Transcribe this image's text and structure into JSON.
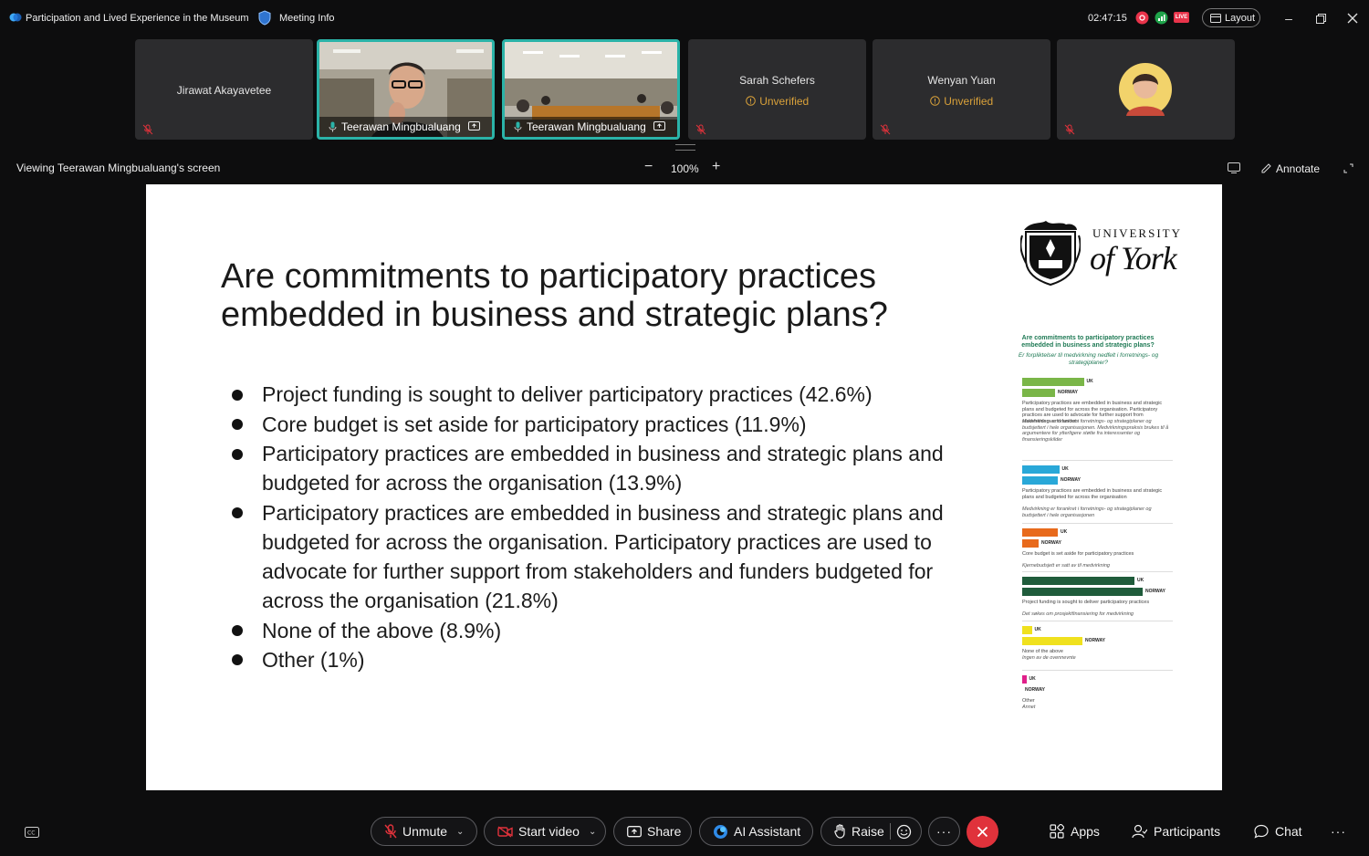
{
  "window": {
    "meeting_title": "Participation and Lived Experience in the Museum",
    "meeting_info": "Meeting Info",
    "elapsed": "02:47:15",
    "live_badge": "LIVE",
    "layout_label": "Layout"
  },
  "participants": [
    {
      "name": "Jirawat Akayavetee",
      "status": "",
      "type": "name"
    },
    {
      "name": "Teerawan Mingbualuang",
      "status": "",
      "type": "video"
    },
    {
      "name": "Teerawan Mingbualuang",
      "status": "",
      "type": "video"
    },
    {
      "name": "Sarah Schefers",
      "status": "Unverified",
      "type": "name"
    },
    {
      "name": "Wenyan Yuan",
      "status": "Unverified",
      "type": "name"
    },
    {
      "name": "",
      "status": "",
      "type": "avatar"
    }
  ],
  "viewbar": {
    "viewing_text": "Viewing Teerawan Mingbualuang's screen",
    "zoom": "100%",
    "annotate": "Annotate"
  },
  "slide": {
    "title": "Are commitments to participatory practices embedded in business and strategic plans?",
    "logo_line1": "UNIVERSITY",
    "logo_line2": "of York",
    "bullets": [
      "Project funding is sought to deliver participatory practices (42.6%)",
      "Core budget is set aside for participatory practices (11.9%)",
      "Participatory practices are embedded in business and strategic plans and budgeted for across the organisation (13.9%)",
      "Participatory practices are embedded in business and strategic plans and budgeted for across the organisation. Participatory practices are used to advocate for further support from stakeholders and funders budgeted for across the organisation (21.8%)",
      "None of the above (8.9%)",
      "Other (1%)"
    ],
    "mini_chart": {
      "title_en": "Are commitments to participatory practices embedded in business and strategic plans?",
      "title_no": "Er forpliktelser til medvirkning nedfelt i forretnings- og strategiplaner?",
      "uk": "UK",
      "norway": "NORWAY",
      "groups": [
        {
          "color": "#7ab648",
          "uk": 0.45,
          "no": 0.24,
          "label": "Participatory practices are embedded in business and strategic plans and budgeted for across the organisation. Participatory practices are used to advocate for further support from stakeholders and funders",
          "label_no": "Medvirkning er forankret i forretnings- og strategiplaner og budsjettert i hele organisasjonen. Medvirkningspraksis brukes til å argumentere for ytterligere støtte fra interessenter og finansieringskilder"
        },
        {
          "color": "#29a8d8",
          "uk": 0.27,
          "no": 0.26,
          "label": "Participatory practices are embedded in business and strategic plans and budgeted for across the organisation",
          "label_no": "Medvirkning er forankret i forretnings- og strategiplaner og budsjettert i hele organisasjonen"
        },
        {
          "color": "#e86a1c",
          "uk": 0.26,
          "no": 0.12,
          "label": "Core budget is set aside for participatory practices",
          "label_no": "Kjernebudsjett er satt av til medvirkning"
        },
        {
          "color": "#1f5c3b",
          "uk": 0.82,
          "no": 0.88,
          "label": "Project funding is sought to deliver participatory practices",
          "label_no": "Det søkes om prosjektfinansiering for medvirkning"
        },
        {
          "color": "#f0e11e",
          "uk": 0.07,
          "no": 0.44,
          "label": "None of the above",
          "label_no": "Ingen av de ovennevnte"
        },
        {
          "color": "#e0208a",
          "uk": 0.03,
          "no": 0.0,
          "label": "Other",
          "label_no": "Annet"
        }
      ]
    }
  },
  "toolbar": {
    "unmute": "Unmute",
    "start_video": "Start video",
    "share": "Share",
    "ai_assistant": "AI Assistant",
    "raise": "Raise",
    "apps": "Apps",
    "participants": "Participants",
    "chat": "Chat"
  },
  "colors": {
    "accent_teal": "#2bb3a8",
    "end_red": "#e0323b",
    "unverified": "#d9a13a"
  }
}
